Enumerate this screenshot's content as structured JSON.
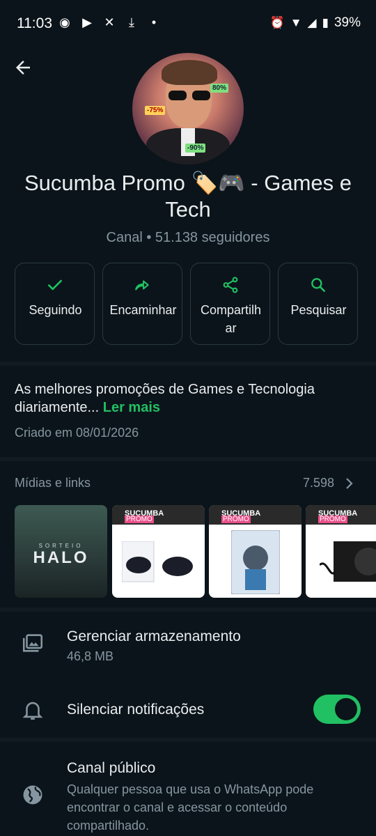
{
  "status_bar": {
    "time": "11:03",
    "battery": "39%"
  },
  "channel": {
    "title": "Sucumba Promo 🏷️🎮  - Games e Tech",
    "meta": "Canal • 51.138 seguidores"
  },
  "actions": [
    {
      "label": "Seguindo",
      "icon": "check-icon"
    },
    {
      "label": "Encaminhar",
      "icon": "forward-icon"
    },
    {
      "label": "Compartilhar",
      "icon": "share-icon"
    },
    {
      "label": "Pesquisar",
      "icon": "search-icon"
    }
  ],
  "description": {
    "text": "As melhores promoções de Games e Tecnologia diariamente...",
    "more": "Ler mais"
  },
  "created": "Criado em 08/01/2026",
  "media": {
    "heading": "Mídias e links",
    "count": "7.598",
    "thumbs": [
      {
        "title": "HALO",
        "subtitle": "SORTEIO"
      },
      {
        "brand": "SUCUMBA",
        "badge": "PROMO"
      },
      {
        "brand": "SUCUMBA",
        "badge": "PROMO"
      },
      {
        "brand": "SUCUMBA",
        "badge": "PROMO"
      }
    ]
  },
  "storage": {
    "title": "Gerenciar armazenamento",
    "size": "46,8 MB"
  },
  "mute": {
    "title": "Silenciar notificações",
    "on": true
  },
  "public": {
    "title": "Canal público",
    "desc": "Qualquer pessoa que usa o WhatsApp pode encontrar o canal e acessar o conteúdo compartilhado."
  },
  "colors": {
    "accent": "#21c063",
    "background": "#0b141a",
    "muted": "#8696a0"
  }
}
